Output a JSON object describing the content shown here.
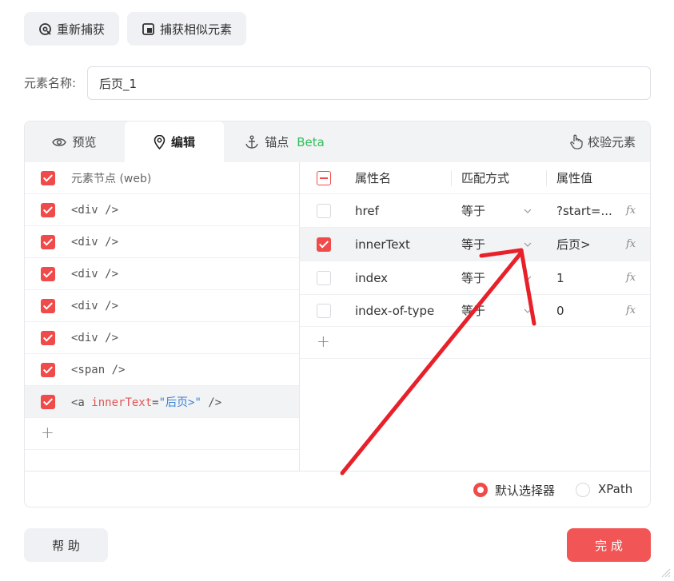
{
  "toolbar": {
    "recapture_label": "重新捕获",
    "capture_similar_label": "捕获相似元素"
  },
  "element_name": {
    "label": "元素名称:",
    "value": "后页_1"
  },
  "tabs": [
    {
      "label": "预览",
      "icon": "eye-icon"
    },
    {
      "label": "编辑",
      "icon": "location-pin-icon"
    },
    {
      "label": "锚点",
      "icon": "anchor-icon",
      "badge": "Beta"
    }
  ],
  "verify_label": "校验元素",
  "nodes": {
    "header": "元素节点 (web)",
    "items": [
      "<div />",
      "<div />",
      "<div />",
      "<div />",
      "<div />",
      "<span />"
    ],
    "last": {
      "open": "<a ",
      "attr": "innerText",
      "eq": "=",
      "value": "\"后页>\"",
      "close": " />"
    }
  },
  "attributes": {
    "headers": {
      "name": "属性名",
      "match": "匹配方式",
      "value": "属性值"
    },
    "rows": [
      {
        "name": "href",
        "match": "等于",
        "value": "?start=...",
        "checked": false
      },
      {
        "name": "innerText",
        "match": "等于",
        "value": "后页>",
        "checked": true
      },
      {
        "name": "index",
        "match": "等于",
        "value": "1",
        "checked": false
      },
      {
        "name": "index-of-type",
        "match": "等于",
        "value": "0",
        "checked": false
      }
    ],
    "fx": "fx"
  },
  "selector": {
    "default_label": "默认选择器",
    "xpath_label": "XPath",
    "selected": "default"
  },
  "footer": {
    "help_label": "帮 助",
    "done_label": "完 成"
  },
  "colors": {
    "accent": "#f04b4b",
    "beta": "#2fbf5a",
    "annotation_arrow": "#e8202a"
  }
}
